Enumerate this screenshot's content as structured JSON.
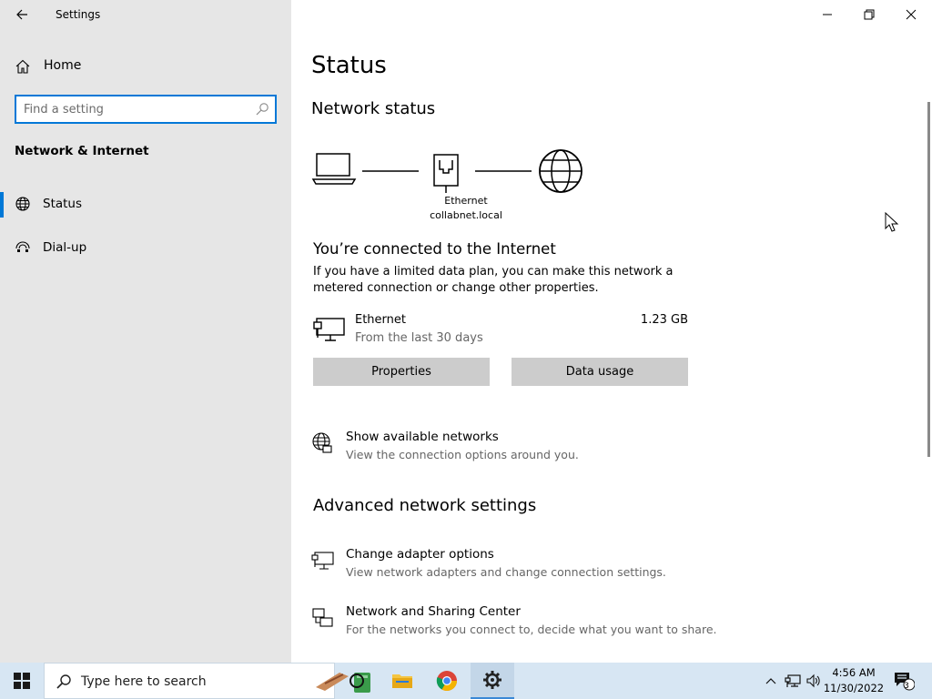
{
  "window": {
    "title": "Settings"
  },
  "sidebar": {
    "home_label": "Home",
    "search_placeholder": "Find a setting",
    "section_title": "Network & Internet",
    "items": [
      {
        "label": "Status",
        "icon": "globe-icon",
        "selected": true
      },
      {
        "label": "Dial-up",
        "icon": "dial-up-icon",
        "selected": false
      }
    ]
  },
  "main": {
    "title": "Status",
    "network_status_heading": "Network status",
    "diagram": {
      "adapter_name": "Ethernet",
      "domain": "collabnet.local"
    },
    "connected_title": "You’re connected to the Internet",
    "connected_desc": "If you have a limited data plan, you can make this network a metered connection or change other properties.",
    "ethernet": {
      "name": "Ethernet",
      "sub": "From the last 30 days",
      "usage": "1.23 GB"
    },
    "buttons": {
      "properties": "Properties",
      "data_usage": "Data usage"
    },
    "show_networks": {
      "title": "Show available networks",
      "desc": "View the connection options around you."
    },
    "advanced_heading": "Advanced network settings",
    "change_adapter": {
      "title": "Change adapter options",
      "desc": "View network adapters and change connection settings."
    },
    "sharing_center": {
      "title": "Network and Sharing Center",
      "desc": "For the networks you connect to, decide what you want to share."
    }
  },
  "taskbar": {
    "search_text": "Type here to search",
    "clock_time": "4:56 AM",
    "clock_date": "11/30/2022",
    "notification_count": "3",
    "accent": "#0078d7"
  }
}
